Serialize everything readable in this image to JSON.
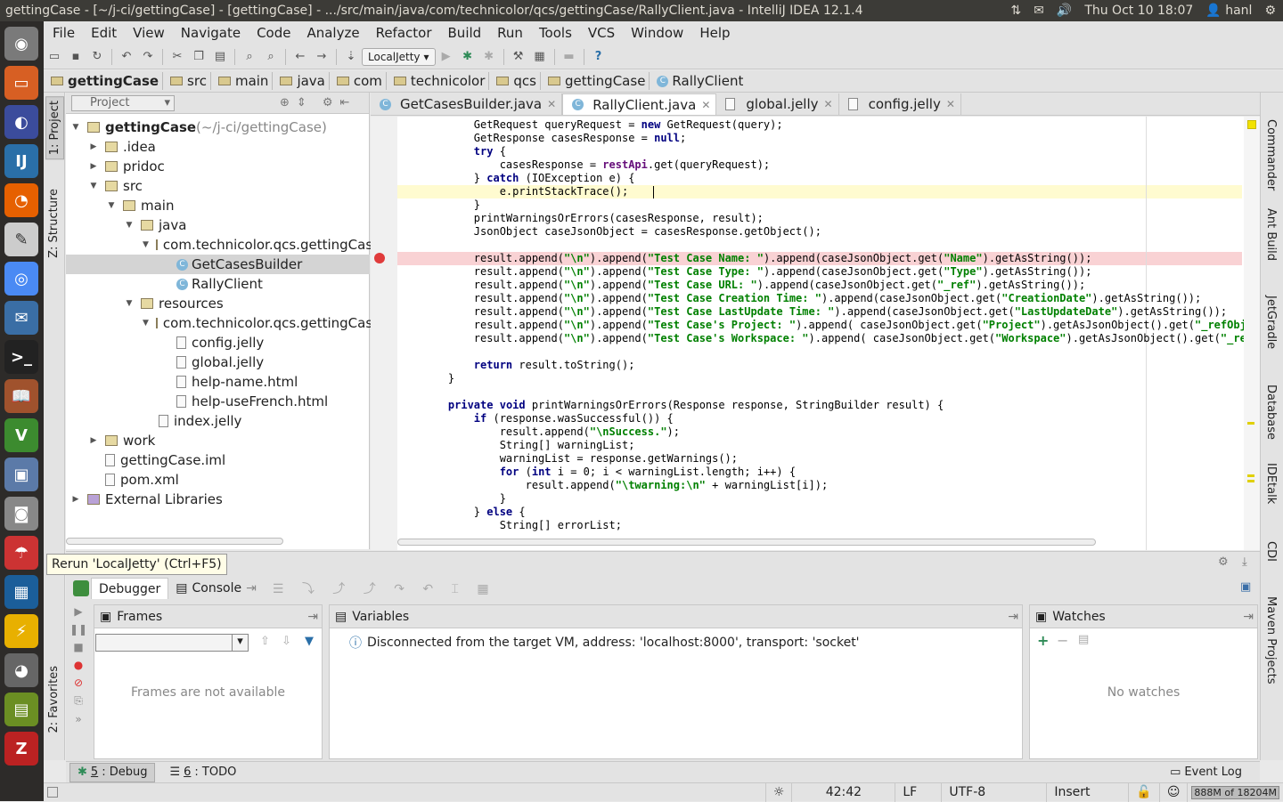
{
  "window": {
    "title": "gettingCase - [~/j-ci/gettingCase] - [gettingCase] - .../src/main/java/com/technicolor/qcs/gettingCase/RallyClient.java - IntelliJ IDEA 12.1.4"
  },
  "system": {
    "clock": "Thu Oct 10 18:07",
    "user": "hanl"
  },
  "menu": [
    "File",
    "Edit",
    "View",
    "Navigate",
    "Code",
    "Analyze",
    "Refactor",
    "Build",
    "Run",
    "Tools",
    "VCS",
    "Window",
    "Help"
  ],
  "toolbar": {
    "run_config": "LocalJetty"
  },
  "breadcrumbs": [
    "gettingCase",
    "src",
    "main",
    "java",
    "com",
    "technicolor",
    "qcs",
    "gettingCase",
    "RallyClient"
  ],
  "project": {
    "selector": "Project",
    "tree": [
      {
        "label": "gettingCase",
        "suffix": " (~/j-ci/gettingCase)",
        "depth": 0,
        "arrow": "down",
        "icon": "folder",
        "bold": true
      },
      {
        "label": ".idea",
        "depth": 1,
        "arrow": "right",
        "icon": "folder"
      },
      {
        "label": "pridoc",
        "depth": 1,
        "arrow": "right",
        "icon": "folder"
      },
      {
        "label": "src",
        "depth": 1,
        "arrow": "down",
        "icon": "folder"
      },
      {
        "label": "main",
        "depth": 2,
        "arrow": "down",
        "icon": "folder"
      },
      {
        "label": "java",
        "depth": 3,
        "arrow": "down",
        "icon": "folder"
      },
      {
        "label": "com.technicolor.qcs.gettingCas",
        "depth": 4,
        "arrow": "down",
        "icon": "folder"
      },
      {
        "label": "GetCasesBuilder",
        "depth": 5,
        "arrow": "",
        "icon": "class",
        "selected": true
      },
      {
        "label": "RallyClient",
        "depth": 5,
        "arrow": "",
        "icon": "class"
      },
      {
        "label": "resources",
        "depth": 3,
        "arrow": "down",
        "icon": "folder"
      },
      {
        "label": "com.technicolor.qcs.gettingCas",
        "depth": 4,
        "arrow": "down",
        "icon": "folder"
      },
      {
        "label": "config.jelly",
        "depth": 5,
        "arrow": "",
        "icon": "file"
      },
      {
        "label": "global.jelly",
        "depth": 5,
        "arrow": "",
        "icon": "file"
      },
      {
        "label": "help-name.html",
        "depth": 5,
        "arrow": "",
        "icon": "file"
      },
      {
        "label": "help-useFrench.html",
        "depth": 5,
        "arrow": "",
        "icon": "file"
      },
      {
        "label": "index.jelly",
        "depth": 4,
        "arrow": "",
        "icon": "file"
      },
      {
        "label": "work",
        "depth": 1,
        "arrow": "right",
        "icon": "folder"
      },
      {
        "label": "gettingCase.iml",
        "depth": 1,
        "arrow": "",
        "icon": "file"
      },
      {
        "label": "pom.xml",
        "depth": 1,
        "arrow": "",
        "icon": "file"
      },
      {
        "label": "External Libraries",
        "depth": 0,
        "arrow": "right",
        "icon": "lib"
      }
    ]
  },
  "tabs": [
    {
      "label": "GetCasesBuilder.java",
      "active": false
    },
    {
      "label": "RallyClient.java",
      "active": true
    },
    {
      "label": "global.jelly",
      "active": false
    },
    {
      "label": "config.jelly",
      "active": false
    }
  ],
  "code": [
    "        GetRequest queryRequest = new GetRequest(query);",
    "        GetResponse casesResponse = null;",
    "        try {",
    "            casesResponse = restApi.get(queryRequest);",
    "        } catch (IOException e) {",
    "            e.printStackTrace();",
    "        }",
    "        printWarningsOrErrors(casesResponse, result);",
    "        JsonObject caseJsonObject = casesResponse.getObject();",
    "",
    "        result.append(\"\\n\").append(\"Test Case Name: \").append(caseJsonObject.get(\"Name\").getAsString());",
    "        result.append(\"\\n\").append(\"Test Case Type: \").append(caseJsonObject.get(\"Type\").getAsString());",
    "        result.append(\"\\n\").append(\"Test Case URL: \").append(caseJsonObject.get(\"_ref\").getAsString());",
    "        result.append(\"\\n\").append(\"Test Case Creation Time: \").append(caseJsonObject.get(\"CreationDate\").getAsString());",
    "        result.append(\"\\n\").append(\"Test Case LastUpdate Time: \").append(caseJsonObject.get(\"LastUpdateDate\").getAsString());",
    "        result.append(\"\\n\").append(\"Test Case's Project: \").append( caseJsonObject.get(\"Project\").getAsJsonObject().get(\"_refObjectName\"",
    "        result.append(\"\\n\").append(\"Test Case's Workspace: \").append( caseJsonObject.get(\"Workspace\").getAsJsonObject().get(\"_refObjectN",
    "",
    "        return result.toString();",
    "    }",
    "",
    "    private void printWarningsOrErrors(Response response, StringBuilder result) {",
    "        if (response.wasSuccessful()) {",
    "            result.append(\"\\nSuccess.\");",
    "            String[] warningList;",
    "            warningList = response.getWarnings();",
    "            for (int i = 0; i < warningList.length; i++) {",
    "                result.append(\"\\twarning:\\n\" + warningList[i]);",
    "            }",
    "        } else {",
    "            String[] errorList;"
  ],
  "debug": {
    "tabs": [
      "Debugger",
      "Console"
    ],
    "frames_title": "Frames",
    "frames_empty": "Frames are not available",
    "variables_title": "Variables",
    "variables_message": "Disconnected from the target VM, address: 'localhost:8000', transport: 'socket'",
    "watches_title": "Watches",
    "watches_empty": "No watches"
  },
  "tooltip": "Rerun 'LocalJetty' (Ctrl+F5)",
  "bottom_tabs": [
    {
      "num": "5",
      "label": ": Debug"
    },
    {
      "num": "6",
      "label": ": TODO"
    }
  ],
  "event_log": "Event Log",
  "status": {
    "position": "42:42",
    "line_sep": "LF",
    "encoding": "UTF-8",
    "mode": "Insert",
    "memory": "888M of 18204M"
  },
  "left_tabs": [
    "1: Project",
    "Z: Structure",
    "2: Favorites"
  ],
  "right_tabs": [
    "Commander",
    "Ant Build",
    "JetGradle",
    "Database",
    "IDEtalk",
    "CDI",
    "Maven Projects"
  ]
}
